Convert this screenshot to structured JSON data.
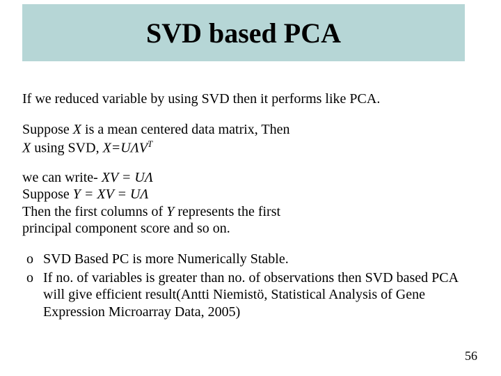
{
  "title": "SVD based PCA",
  "intro": "If we reduced variable by using SVD then it performs like PCA.",
  "p2": {
    "l1a": "Suppose ",
    "l1x": "X",
    "l1b": " is a mean centered data matrix, Then",
    "l2a": "X",
    "l2b": " using SVD,  ",
    "l2c": "X=UΛV",
    "l2sup": "T"
  },
  "p3": {
    "l1a": "we can write- ",
    "l1b": "XV = UΛ",
    "l2a": "Suppose   ",
    "l2b": "Y = XV = UΛ",
    "l3a": "Then the first columns of ",
    "l3y": "Y",
    "l3b": " represents the first",
    "l4": "principal component score and so on."
  },
  "bullets": {
    "b1": "SVD Based PC is more Numerically Stable.",
    "b2": "If no. of variables is greater than no. of observations then SVD based PCA will give efficient result(Antti Niemistö, Statistical Analysis of Gene Expression Microarray Data, 2005)"
  },
  "page_number": "56"
}
